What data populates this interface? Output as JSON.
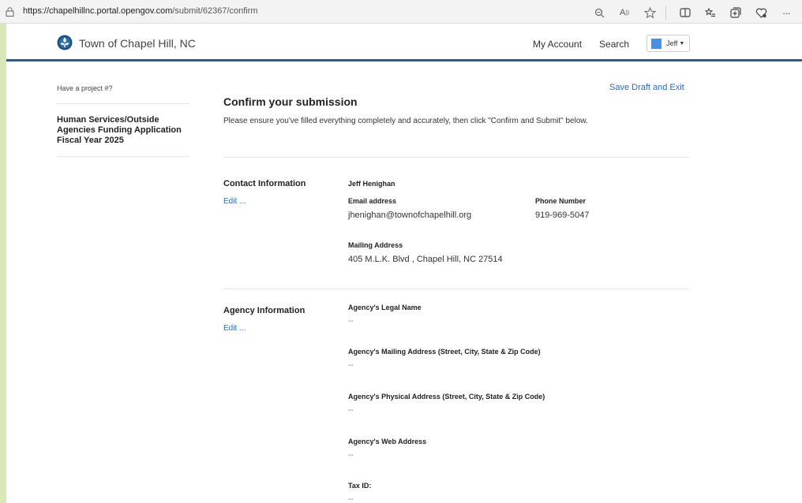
{
  "browser": {
    "url_host": "https://chapelhillnc.portal.opengov.com",
    "url_path": "/submit/62367/confirm"
  },
  "header": {
    "site_title": "Town of Chapel Hill, NC",
    "nav": {
      "my_account": "My Account",
      "search": "Search"
    },
    "user": {
      "name": "Jeff"
    }
  },
  "sidebar": {
    "project_question": "Have a project #?",
    "application_name": "Human Services/Outside Agencies Funding Application Fiscal Year 2025"
  },
  "main": {
    "save_draft": "Save Draft and Exit",
    "title": "Confirm your submission",
    "description": "Please ensure you've filled everything completely and accurately, then click \"Confirm and Submit\" below."
  },
  "contact": {
    "section_title": "Contact Information",
    "edit": "Edit ...",
    "name": "Jeff Henighan",
    "email_label": "Email address",
    "email_value": "jhenighan@townofchapelhill.org",
    "phone_label": "Phone Number",
    "phone_value": "919-969-5047",
    "mailing_label": "Mailing Address",
    "mailing_value": "405 M.L.K. Blvd , Chapel Hill, NC 27514"
  },
  "agency": {
    "section_title": "Agency Information",
    "edit": "Edit ...",
    "fields": [
      {
        "label": "Agency's Legal Name",
        "value": "--"
      },
      {
        "label": "Agency's Mailing Address (Street, City, State & Zip Code)",
        "value": "--"
      },
      {
        "label": "Agency's Physical Address (Street, City, State & Zip Code)",
        "value": "--"
      },
      {
        "label": "Agency's Web Address",
        "value": "--"
      },
      {
        "label": "Tax ID:",
        "value": "--"
      }
    ]
  }
}
